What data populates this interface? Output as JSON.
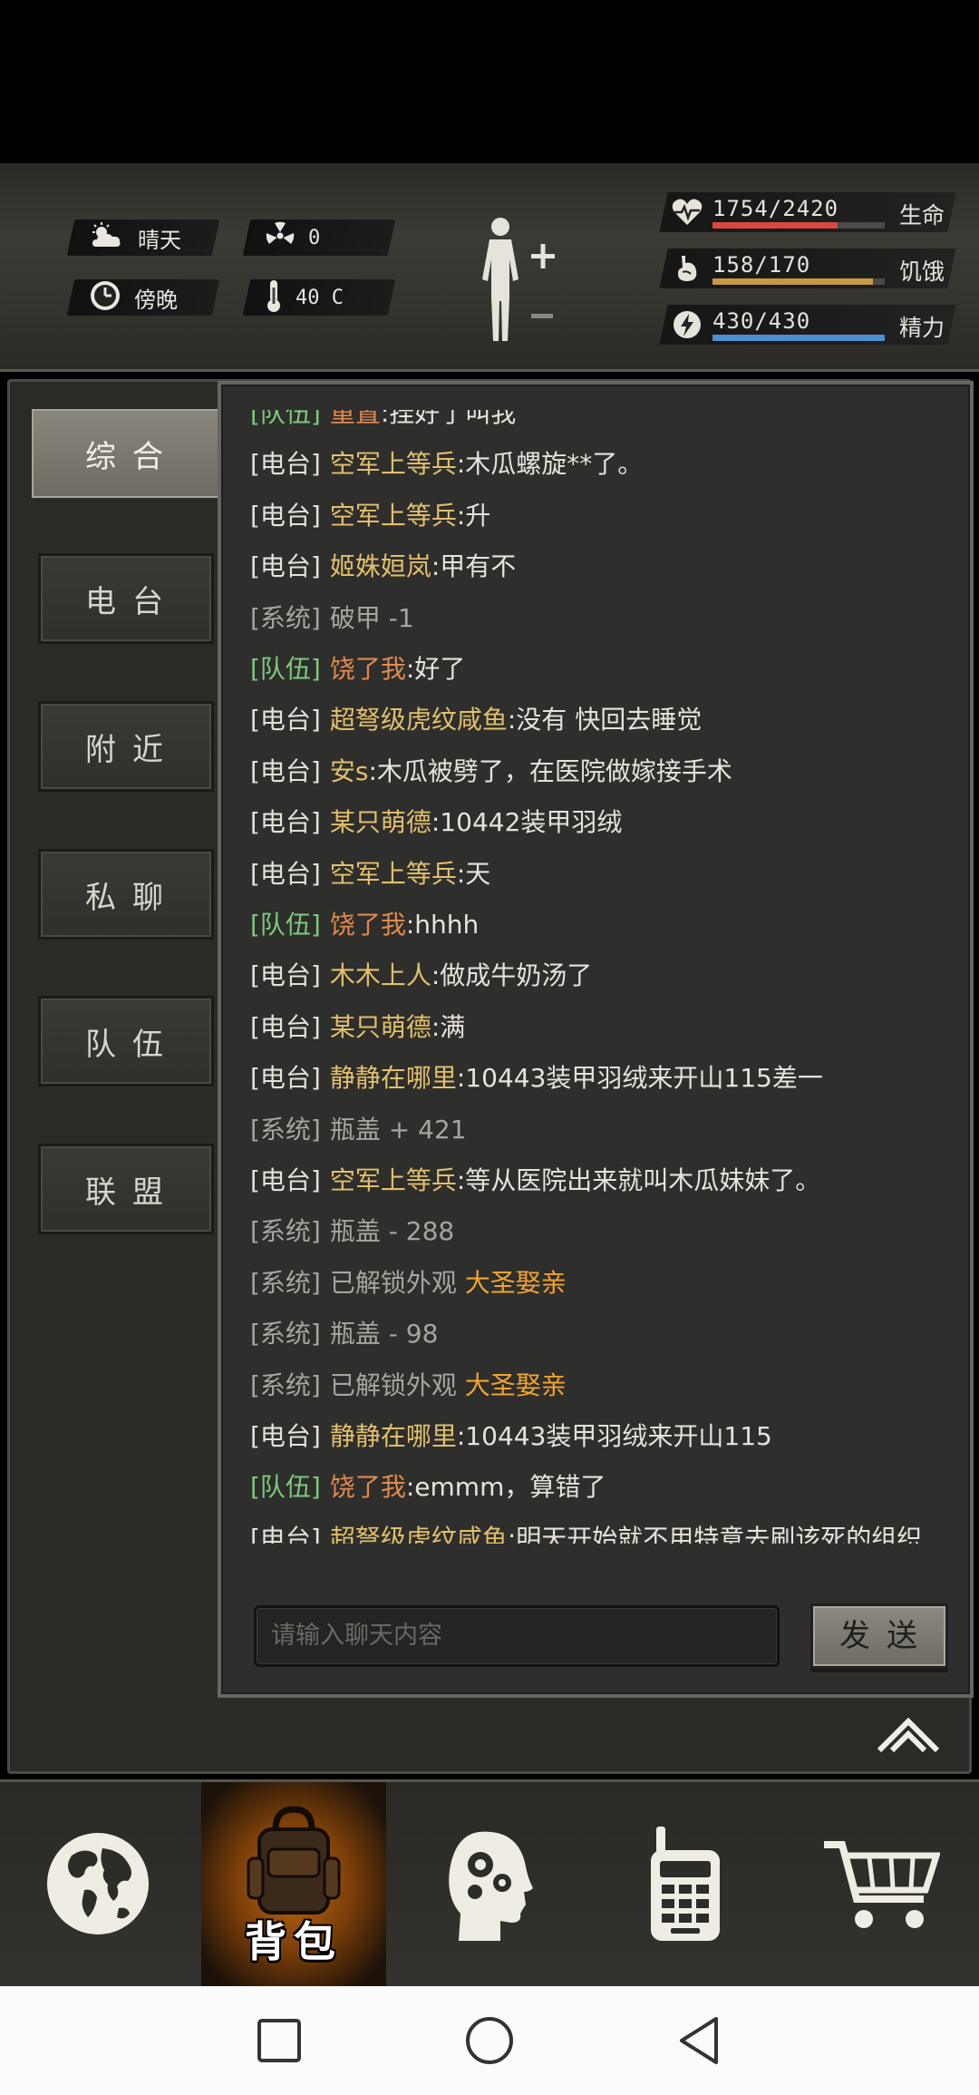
{
  "environment": {
    "weather": "晴天",
    "radiation": "0",
    "time_of_day": "傍晚",
    "temperature": "40 C"
  },
  "stats": [
    {
      "key": "health",
      "value": "1754/2420",
      "label": "生命",
      "fraction": 0.725,
      "color": "#d9473e",
      "icon": "heart-pulse-icon"
    },
    {
      "key": "hunger",
      "value": "158/170",
      "label": "饥饿",
      "fraction": 0.929,
      "color": "#c59a45",
      "icon": "stomach-icon"
    },
    {
      "key": "energy",
      "value": "430/430",
      "label": "精力",
      "fraction": 1.0,
      "color": "#4d8fce",
      "icon": "lightning-icon"
    }
  ],
  "tabs": [
    {
      "label": "综合",
      "active": true
    },
    {
      "label": "电台",
      "active": false
    },
    {
      "label": "附近",
      "active": false
    },
    {
      "label": "私聊",
      "active": false
    },
    {
      "label": "队伍",
      "active": false
    },
    {
      "label": "联盟",
      "active": false
    }
  ],
  "colors": {
    "radio_channel": "#e4e1d8",
    "system_channel": "#a8a59d",
    "team_channel": "#7fc97a",
    "radio_name": "#e2c06a",
    "team_name": "#e08a4e",
    "system_text": "#a8a59d",
    "highlight": "#f1a42b",
    "text": "#e6e3da"
  },
  "chat": {
    "messages": [
      {
        "channel": "[队伍]",
        "type": "team",
        "name": "重置",
        "text": ":挂好了叫我"
      },
      {
        "channel": "[电台]",
        "type": "radio",
        "name": "空军上等兵",
        "text": ":木瓜螺旋**了。"
      },
      {
        "channel": "[电台]",
        "type": "radio",
        "name": "空军上等兵",
        "text": ":升"
      },
      {
        "channel": "[电台]",
        "type": "radio",
        "name": "姬姝姮岚",
        "text": ":甲有不"
      },
      {
        "channel": "[系统]",
        "type": "system",
        "name": "",
        "text": "破甲 -1"
      },
      {
        "channel": "[队伍]",
        "type": "team",
        "name": "饶了我",
        "text": ":好了"
      },
      {
        "channel": "[电台]",
        "type": "radio",
        "name": "超弩级虎纹咸鱼",
        "text": ":没有 快回去睡觉"
      },
      {
        "channel": "[电台]",
        "type": "radio",
        "name": "安s",
        "text": ":木瓜被劈了，在医院做嫁接手术"
      },
      {
        "channel": "[电台]",
        "type": "radio",
        "name": "某只萌德",
        "text": ":10442装甲羽绒"
      },
      {
        "channel": "[电台]",
        "type": "radio",
        "name": "空军上等兵",
        "text": ":天"
      },
      {
        "channel": "[队伍]",
        "type": "team",
        "name": "饶了我",
        "text": ":hhhh"
      },
      {
        "channel": "[电台]",
        "type": "radio",
        "name": "木木上人",
        "text": ":做成牛奶汤了"
      },
      {
        "channel": "[电台]",
        "type": "radio",
        "name": "某只萌德",
        "text": ":满"
      },
      {
        "channel": "[电台]",
        "type": "radio",
        "name": "静静在哪里",
        "text": ":10443装甲羽绒来开山115差一"
      },
      {
        "channel": "[系统]",
        "type": "system",
        "name": "",
        "text": "瓶盖 + 421"
      },
      {
        "channel": "[电台]",
        "type": "radio",
        "name": "空军上等兵",
        "text": ":等从医院出来就叫木瓜妹妹了。"
      },
      {
        "channel": "[系统]",
        "type": "system",
        "name": "",
        "text": "瓶盖 - 288"
      },
      {
        "channel": "[系统]",
        "type": "system",
        "name": "",
        "text": "已解锁外观 ",
        "highlight": "大圣娶亲"
      },
      {
        "channel": "[系统]",
        "type": "system",
        "name": "",
        "text": "瓶盖 - 98"
      },
      {
        "channel": "[系统]",
        "type": "system",
        "name": "",
        "text": "已解锁外观 ",
        "highlight": "大圣娶亲"
      },
      {
        "channel": "[电台]",
        "type": "radio",
        "name": "静静在哪里",
        "text": ":10443装甲羽绒来开山115"
      },
      {
        "channel": "[队伍]",
        "type": "team",
        "name": "饶了我",
        "text": ":emmm，算错了"
      },
      {
        "channel": "[电台]",
        "type": "radio",
        "name": "超弩级虎纹咸鱼",
        "text": ":明天开始就不用特意去刷该死的组织"
      }
    ],
    "input_placeholder": "请输入聊天内容",
    "send_label": "发送"
  },
  "bottom_nav": [
    {
      "icon": "globe-icon",
      "label": "",
      "active": false
    },
    {
      "icon": "backpack-icon",
      "label": "背包",
      "active": true
    },
    {
      "icon": "head-gears-icon",
      "label": "",
      "active": false
    },
    {
      "icon": "walkie-talkie-icon",
      "label": "",
      "active": false
    },
    {
      "icon": "shopping-cart-icon",
      "label": "",
      "active": false
    }
  ]
}
